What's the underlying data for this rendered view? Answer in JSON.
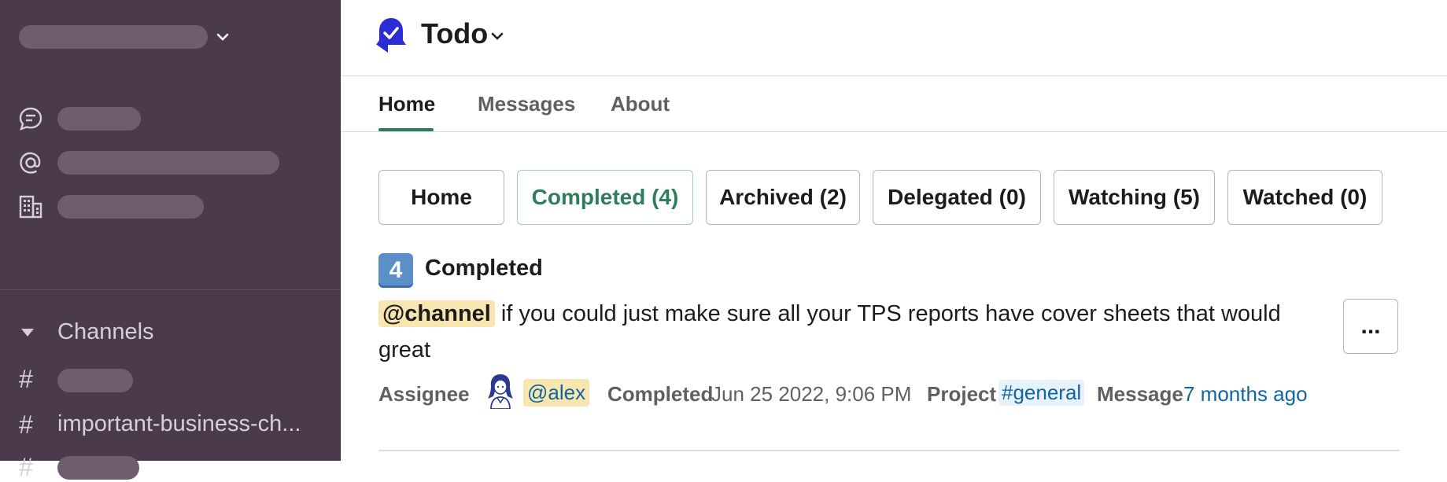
{
  "sidebar": {
    "sections_label": "Channels",
    "channels": [
      {
        "name": ""
      },
      {
        "name": "important-business-ch..."
      },
      {
        "name": ""
      }
    ]
  },
  "header": {
    "app_name": "Todo",
    "app_icon": "bell-check-icon"
  },
  "tabs": [
    {
      "label": "Home",
      "active": true
    },
    {
      "label": "Messages",
      "active": false
    },
    {
      "label": "About",
      "active": false
    }
  ],
  "filters": [
    {
      "label": "Home",
      "selected": false
    },
    {
      "label": "Completed (4)",
      "selected": true
    },
    {
      "label": "Archived (2)",
      "selected": false
    },
    {
      "label": "Delegated (0)",
      "selected": false
    },
    {
      "label": "Watching (5)",
      "selected": false
    },
    {
      "label": "Watched (0)",
      "selected": false
    }
  ],
  "section": {
    "count": "4",
    "title": "Completed"
  },
  "todo": {
    "mention": "@channel",
    "text_line1": " if you could just make sure all your TPS reports have cover sheets that would",
    "text_line2": "great",
    "more_label": "...",
    "assignee_label": "Assignee",
    "assignee": "@alex",
    "completed_label": "Completed",
    "completed_value": "Jun 25 2022, 9:06 PM",
    "project_label": "Project",
    "project_value": "#general",
    "message_label": "Message",
    "message_value": "7 months ago"
  },
  "colors": {
    "sidebar_bg": "#4a3a4b",
    "accent_green": "#2e7d5b",
    "link_blue": "#1264a3",
    "mention_bg": "#f7e6b0"
  }
}
